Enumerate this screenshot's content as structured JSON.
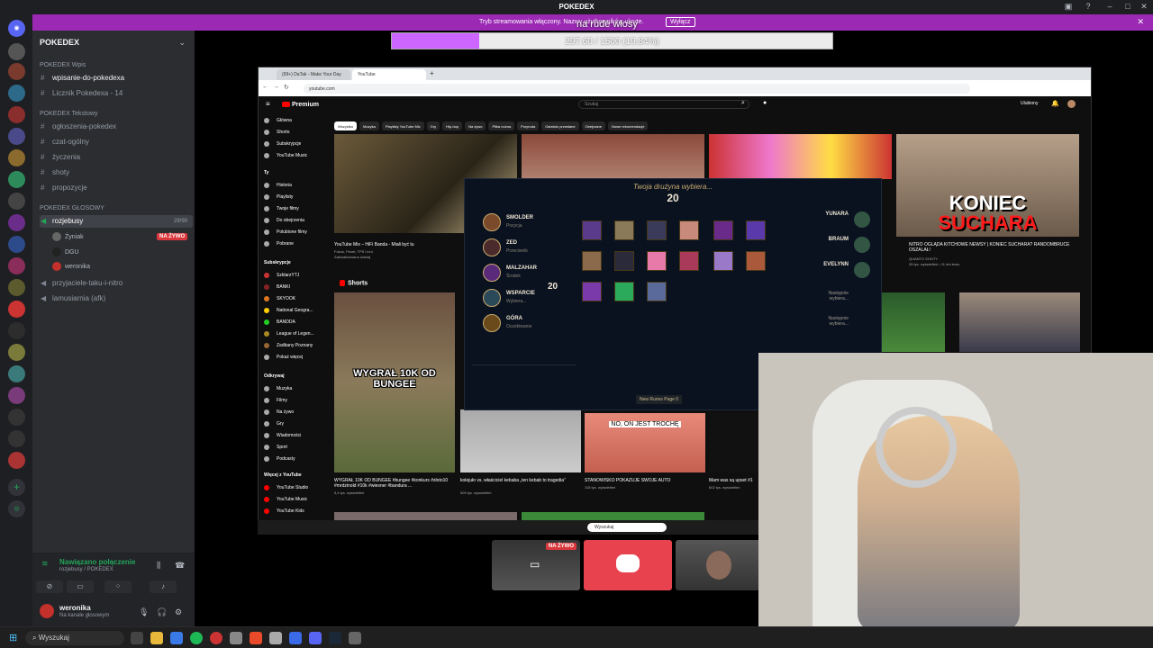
{
  "window": {
    "title": "POKEDEX"
  },
  "banner": {
    "text": "Tryb streamowania włączony. Nazwy użytkowników ukryte.",
    "button": "Wyłącz"
  },
  "overlay": {
    "title": "na rude włosy",
    "progress_text": "297.60 / 1500 (19.84%)",
    "progress_fraction": 0.1984
  },
  "server": {
    "name": "POKEDEX",
    "categories": [
      {
        "name": "POKEDEX Wpis",
        "channels": [
          "wpisanie-do-pokedexa",
          "Licznik Pokedexa - 14"
        ]
      },
      {
        "name": "POKEDEX Tekstowy",
        "channels": [
          "ogłoszenia-pokedex",
          "czat-ogólny",
          "życzenia",
          "shoty",
          "propozycje"
        ]
      },
      {
        "name": "POKEDEX GŁOSOWY",
        "channels": [
          "rozjebusy",
          "przyjaciele-taku-i-nitro",
          "lamusiarnia (afk)"
        ]
      }
    ],
    "active_voice_count": "29/99",
    "voice_users": [
      "Żyniak",
      "DGU",
      "weronika"
    ],
    "live_badge": "NA ŻYWO"
  },
  "voice_panel": {
    "status": "Nawiązano połączenie",
    "channel": "rozjebusy / POKEDEX",
    "user": "weronika",
    "user_status": "Na kanale głosowym"
  },
  "browser": {
    "tabs": [
      "(99+) DaTak - Make Your Day",
      "YouTube"
    ],
    "url": "youtube.com"
  },
  "youtube": {
    "logo": "Premium",
    "search_placeholder": "Szukaj",
    "sign_in": "Ulubiony",
    "chips": [
      "Wszystko",
      "Muzyka",
      "Playlisty YouTube Mix",
      "Gry",
      "Hip-hop",
      "Na żywo",
      "Piłka nożna",
      "Przyroda",
      "Ostatnio przesłane",
      "Obejrzane",
      "Nowe rekomendacje"
    ],
    "sidebar": {
      "main": [
        "Główna",
        "Shorts",
        "Subskrypcje",
        "YouTube Music"
      ],
      "you_header": "Ty",
      "you": [
        "Historia",
        "Playlisty",
        "Twoje filmy",
        "Do obejrzenia",
        "Polubione filmy",
        "Pobrane"
      ],
      "subs_header": "Subskrypcje",
      "subs": [
        "SzklarzYTJ",
        "BANKI",
        "SKYOOK",
        "National Geogra...",
        "BANDDA",
        "League of Legen...",
        "Zadbany Poznany",
        "Pokaż więcej"
      ],
      "explore_header": "Odkrywaj",
      "explore": [
        "Muzyka",
        "Filmy",
        "Na żywo",
        "Gry",
        "Wiadomości",
        "Sport",
        "Podcasty"
      ],
      "more_header": "Więcej z YouTube",
      "more": [
        "YouTube Studio",
        "YouTube Music",
        "YouTube Kids"
      ]
    },
    "videos": [
      {
        "title": "YouTube Mix – HiFi Banda - Miałi być tu",
        "meta": "Fokus, Pezet, TPS i inni",
        "meta2": "Zaktualizowano dzisiaj"
      },
      {
        "title": "NITRO OGLĄDA KITCHOWE NEWSY | KONIEC SUCHARA? RANDOMBRUCE OSZALAŁ!",
        "meta": "QUANTO SHOTY",
        "meta2": "39 tys. wyświetleń • 11 dni temu"
      }
    ],
    "thumb_koniec": [
      "KONIEC",
      "SUCHARA"
    ],
    "shorts_header": "Shorts",
    "shorts": [
      {
        "caption": "WYGRAŁ 10K OD BUNGEE",
        "title": "WYGRAŁ 10K OD BUNGEE #bungee #konkurs #złoto10 #mrdzinold #10k #wiesner #bandura ...",
        "meta": "5,4 tys. wyświetleń"
      },
      {
        "caption": "",
        "title": "kolejuło vs. właściciel kebaba „ten kebab to tragedia”",
        "meta": "509 tys. wyświetleń"
      },
      {
        "caption": "NO, ON JEST TROCHĘ",
        "title": "STANOWISKO POKAZUJE SWOJE AUTO",
        "meta": "118 tys. wyświetleń"
      },
      {
        "caption": "",
        "title": "Mam was są upset #1",
        "meta": "602 tys. wyświetleń"
      }
    ]
  },
  "league": {
    "header": "Twoja drużyna wybiera...",
    "timer": "20",
    "ally": [
      {
        "name": "SMOLDER",
        "sub": "Pozycja"
      },
      {
        "name": "ZED",
        "sub": "Przeciwnik"
      },
      {
        "name": "MALZAHAR",
        "sub": "Środek"
      },
      {
        "name": "WSPARCIE",
        "sub": "Wybiera..."
      },
      {
        "name": "GÓRA",
        "sub": "Oczekiwanie"
      }
    ],
    "enemy": [
      "YUNARA",
      "BRAUM",
      "EVELYNN",
      "Następnie wybiera...",
      "Następnie wybiera..."
    ],
    "runes_label": "New Runes Page 0",
    "second_timer": "20"
  },
  "taskbar_inner": {
    "search": "Wyszukaj"
  },
  "stream_tiles": {
    "live_badge": "NA ŻYWO"
  },
  "taskbar": {
    "search": "Wyszukaj"
  }
}
